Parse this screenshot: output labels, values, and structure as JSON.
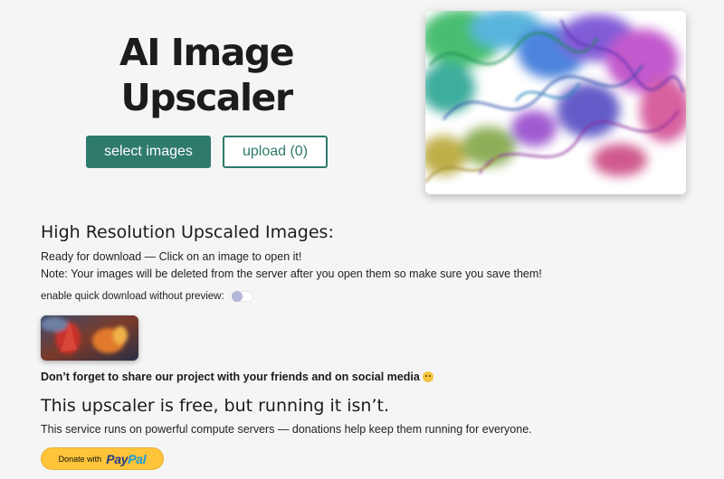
{
  "hero": {
    "title": "AI Image Upscaler",
    "select_label": "select images",
    "upload_label": "upload (0)"
  },
  "results": {
    "heading": "High Resolution Upscaled Images:",
    "ready_text": "Ready for download — Click on an image to open it!",
    "note_text": "Note: Your images will be deleted from the server after you open them so make sure you save them!",
    "quick_download_label": "enable quick download without preview:",
    "quick_download_enabled": false
  },
  "share": {
    "text": "Don’t forget to share our project with your friends and on social media"
  },
  "donation": {
    "heading": "This upscaler is free, but running it isn’t.",
    "text": "This service runs on powerful compute servers — donations help keep them running for everyone.",
    "button_prefix": "Donate with",
    "button_brand_pay": "Pay",
    "button_brand_pal": "Pal"
  },
  "colors": {
    "accent": "#2e7a6b",
    "background": "#f5f5f5",
    "paypal_yellow": "#ffc439",
    "toggle_knob": "#b3b6d9"
  },
  "icons": {
    "share_emoji": "smiling-face-emoji"
  }
}
